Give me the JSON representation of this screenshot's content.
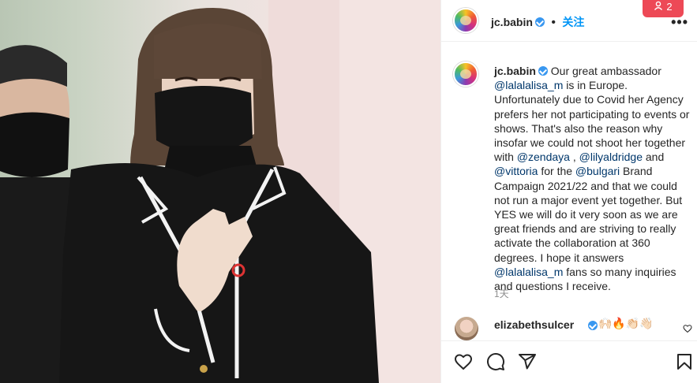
{
  "post": {
    "author": "jc.babin",
    "follow_label": "关注",
    "more_label": "•••",
    "notification_count": "2",
    "caption": {
      "part1": "Our great ambassador ",
      "mention1": "@lalalalisa_m",
      "part2": " is in Europe. Unfortunately due to Covid her Agency prefers her not participating to events or shows. That's also the reason why insofar we could not shoot her together with ",
      "mention2": "@zendaya",
      "part3": " , ",
      "mention3": "@lilyaldridge",
      "part4": " and ",
      "mention4": "@vittoria",
      "part5": " for the ",
      "mention5": "@bulgari",
      "part6": " Brand Campaign 2021/22 and that we could not run a major event yet together. But YES we will do it very soon as we are great friends and are striving to really activate the collaboration at 360 degrees. I hope it answers ",
      "mention6": "@lalalalisa_m",
      "part7": " fans so many inquiries and questions I receive."
    },
    "time_ago": "1天"
  },
  "comments": [
    {
      "user": "elizabethsulcer",
      "emojis": "🙌🏻🔥👏🏻👋🏻"
    }
  ],
  "icons": {
    "like": "heart-icon",
    "comment": "comment-icon",
    "share": "share-icon",
    "save": "bookmark-icon",
    "verified": "verified-badge-icon",
    "notification": "person-notification-icon"
  },
  "colors": {
    "link": "#00376b",
    "follow": "#0095f6",
    "verified": "#3897f0",
    "notification": "#ed4956"
  }
}
